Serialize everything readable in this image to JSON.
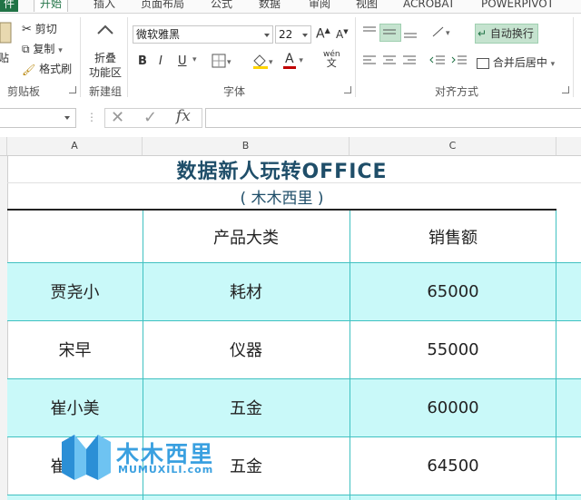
{
  "ribbon_tabs": [
    "件",
    "开始",
    "插入",
    "页面布局",
    "公式",
    "数据",
    "审阅",
    "视图",
    "ACROBAT",
    "POWERPIVOT"
  ],
  "clipboard": {
    "paste_label": "贴",
    "cut_label": "剪切",
    "copy_label": "复制",
    "format_painter_label": "格式刷",
    "group_label": "剪贴板"
  },
  "new_group": {
    "collapse_label_1": "折叠",
    "collapse_label_2": "功能区",
    "group_label": "新建组"
  },
  "font": {
    "font_name": "微软雅黑",
    "font_size": "22",
    "group_label": "字体",
    "bold": "B",
    "italic": "I",
    "underline": "U",
    "grow": "A",
    "shrink": "A",
    "font_color_letter": "A",
    "phonetic_top": "wén",
    "phonetic_bottom": "文"
  },
  "alignment": {
    "wrap_text_label": "自动换行",
    "merge_center_label": "合并后居中",
    "group_label": "对齐方式"
  },
  "formula_bar": {
    "fx_label": "fx",
    "value": ""
  },
  "columns": [
    "A",
    "B",
    "C"
  ],
  "sheet": {
    "title": "数据新人玩转OFFICE",
    "subtitle": "( 木木西里 )",
    "header": [
      "",
      "产品大类",
      "销售额"
    ],
    "rows": [
      [
        "贾尧小",
        "耗材",
        "65000"
      ],
      [
        "宋早",
        "仪器",
        "55000"
      ],
      [
        "崔小美",
        "五金",
        "60000"
      ],
      [
        "崔地方",
        "五金",
        "64500"
      ]
    ]
  },
  "watermark": {
    "name": "木木西里",
    "domain": "MUMUXILI.com"
  },
  "colors": {
    "row_highlight": "#c9f9f9",
    "grid_line": "#3fc1c1",
    "title_text": "#1f4e69",
    "excel_green": "#217346"
  }
}
